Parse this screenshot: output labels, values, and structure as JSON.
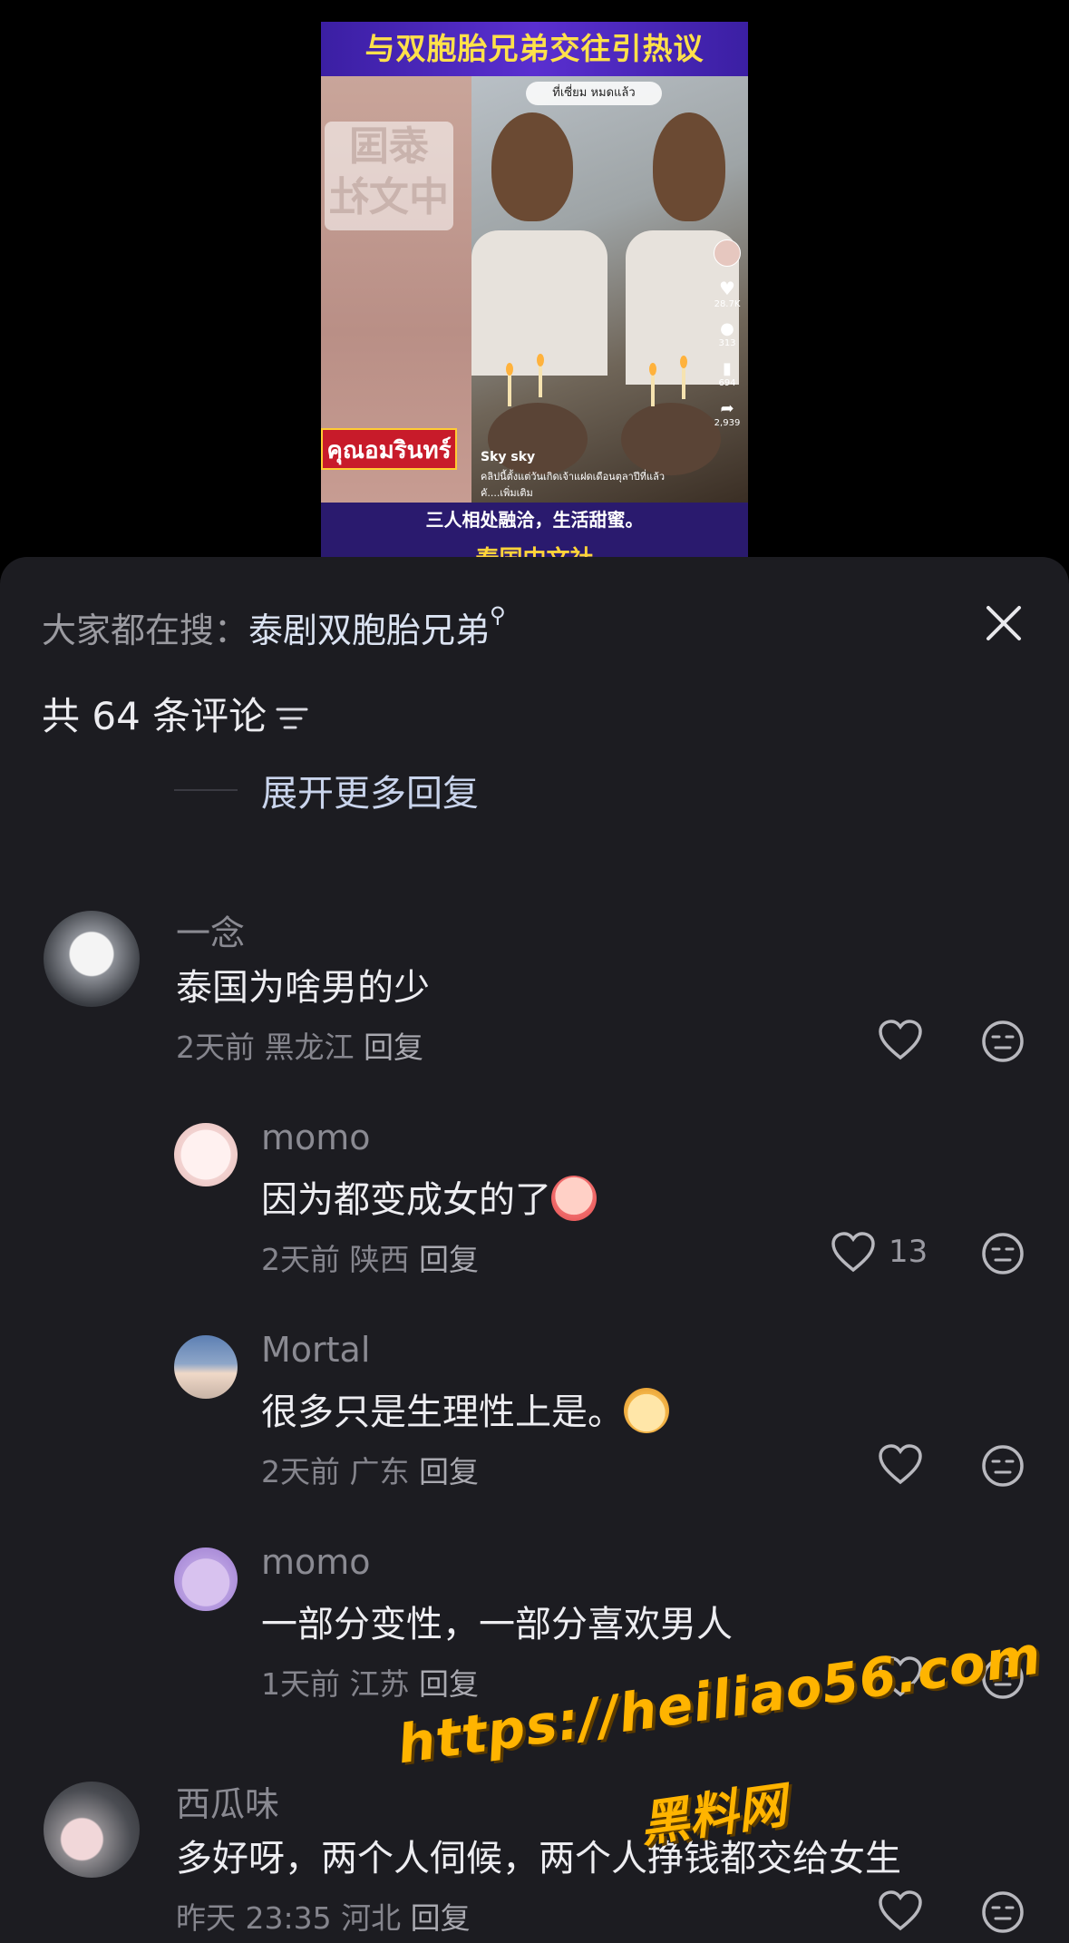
{
  "video": {
    "title": "与双胞胎兄弟交往引热议",
    "logo_text": "泰国 中文社",
    "banner_text": "คุณอมรินทร์",
    "tiktok_pill": "ที่เซี่ยม หมดแล้ว",
    "like_count": "28.7K",
    "comment_count": "313",
    "save_count": "694",
    "share_count": "2,939",
    "creator": "Sky sky",
    "caption": "คลิปนี้ตั้งแต่วันเกิดเจ้าแฝดเดือนตุลาปีที่แล้ว คั....เพิ่มเติม",
    "subtitle": "三人相处融洽，生活甜蜜。",
    "source_tag": "泰国中文社"
  },
  "sheet": {
    "search_prefix": "大家都在搜：",
    "search_keyword": "泰剧双胞胎兄弟",
    "comment_count_label": "共 64 条评论",
    "expand_label": "展开更多回复"
  },
  "comments": [
    {
      "name": "一念",
      "text": "泰国为啥男的少",
      "time": "2天前",
      "location": "黑龙江",
      "reply": "回复",
      "likes": ""
    },
    {
      "name": "momo",
      "text": "因为都变成女的了",
      "time": "2天前",
      "location": "陕西",
      "reply": "回复",
      "likes": "13"
    },
    {
      "name": "Mortal",
      "text": "很多只是生理性上是。",
      "time": "2天前",
      "location": "广东",
      "reply": "回复",
      "likes": ""
    },
    {
      "name": "momo",
      "text": "一部分变性，一部分喜欢男人",
      "time": "1天前",
      "location": "江苏",
      "reply": "回复",
      "likes": ""
    },
    {
      "name": "西瓜味",
      "text": "多好呀，两个人伺候，两个人挣钱都交给女生",
      "time": "昨天 23:35",
      "location": "河北",
      "reply": "回复",
      "likes": ""
    }
  ],
  "watermark": {
    "url": "https://heiliao56.com",
    "name": "黑料网"
  },
  "colors": {
    "sheet_bg": "#1c1c21",
    "keyword": "#dbe3f2",
    "watermark": "#ffb400"
  }
}
